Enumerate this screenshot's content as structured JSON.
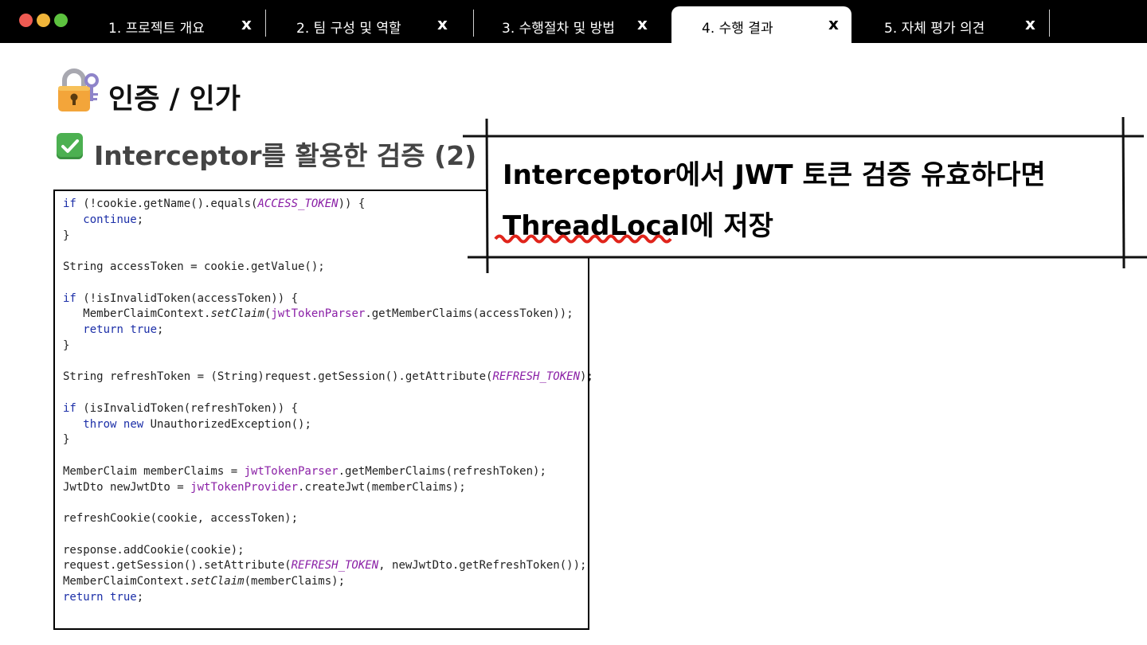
{
  "window": {
    "traffic_lights": [
      "#ee5a52",
      "#f0b53a",
      "#5dc23f"
    ]
  },
  "tabs": [
    {
      "label": "1. 프로젝트 개요",
      "close": "x",
      "active": false
    },
    {
      "label": "2. 팀 구성 및 역할",
      "close": "x",
      "active": false
    },
    {
      "label": "3. 수행절차 및 방법",
      "close": "x",
      "active": false
    },
    {
      "label": "4. 수행 결과",
      "close": "x",
      "active": true
    },
    {
      "label": "5. 자체 평가 의견",
      "close": "x",
      "active": false
    }
  ],
  "slide": {
    "title": "인증 / 인가",
    "title_icon": "lock-with-key-icon",
    "subtitle": "Interceptor를 활용한 검증 (2)",
    "subtitle_icon": "check-mark-button-icon",
    "callout": {
      "line1": "Interceptor에서 JWT 토큰 검증 유효하다면",
      "line2_underlined": "ThreadLocal",
      "line2_rest": "에 저장",
      "underline_color": "#e0241b"
    },
    "code": {
      "tokens": [
        "if",
        " (!cookie.getName().equals(",
        "ACCESS_TOKEN",
        ")) {\n   ",
        "continue",
        ";\n}\n\nString accessToken = cookie.getValue();\n\n",
        "if",
        " (!isInvalidToken(accessToken)) {\n   MemberClaimContext.",
        "setClaim",
        "(",
        "jwtTokenParser",
        ".getMemberClaims(accessToken));\n   ",
        "return",
        " ",
        "true",
        ";\n}\n\nString refreshToken = (String)request.getSession().getAttribute(",
        "REFRESH_TOKEN",
        ");\n\n",
        "if",
        " (isInvalidToken(refreshToken)) {\n   ",
        "throw",
        " ",
        "new",
        " UnauthorizedException();\n}\n\nMemberClaim memberClaims = ",
        "jwtTokenParser",
        ".getMemberClaims(refreshToken);\nJwtDto newJwtDto = ",
        "jwtTokenProvider",
        ".createJwt(memberClaims);\n\nrefreshCookie(cookie, accessToken);\n\nresponse.addCookie(cookie);\nrequest.getSession().setAttribute(",
        "REFRESH_TOKEN",
        ", newJwtDto.getRefreshToken());\nMemberClaimContext.",
        "setClaim",
        "(memberClaims);\n",
        "return",
        " ",
        "true",
        ";"
      ],
      "token_styles": [
        "kw",
        "",
        "cst",
        "",
        "kw",
        "",
        "kw",
        "",
        "it",
        "",
        "fld",
        "",
        "kw",
        "",
        "kw",
        "",
        "cst",
        "",
        "kw",
        "",
        "kw",
        "",
        "kw",
        "",
        "fld",
        "",
        "fld",
        "",
        "cst",
        "",
        "it",
        "",
        "kw",
        "",
        "kw",
        ""
      ]
    }
  }
}
